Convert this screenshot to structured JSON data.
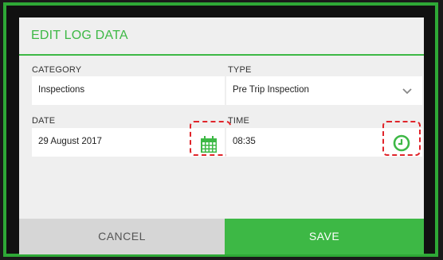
{
  "dialog": {
    "title": "EDIT LOG DATA",
    "accent_color": "#3db845"
  },
  "category": {
    "label": "CATEGORY",
    "value": "Inspections"
  },
  "type": {
    "label": "TYPE",
    "value": "Pre Trip Inspection",
    "icon": "chevron-down-icon"
  },
  "date": {
    "label": "DATE",
    "value": "29 August 2017",
    "icon": "calendar-icon"
  },
  "time": {
    "label": "TIME",
    "value": "08:35",
    "icon": "clock-icon"
  },
  "actions": {
    "cancel_label": "CANCEL",
    "save_label": "SAVE"
  }
}
